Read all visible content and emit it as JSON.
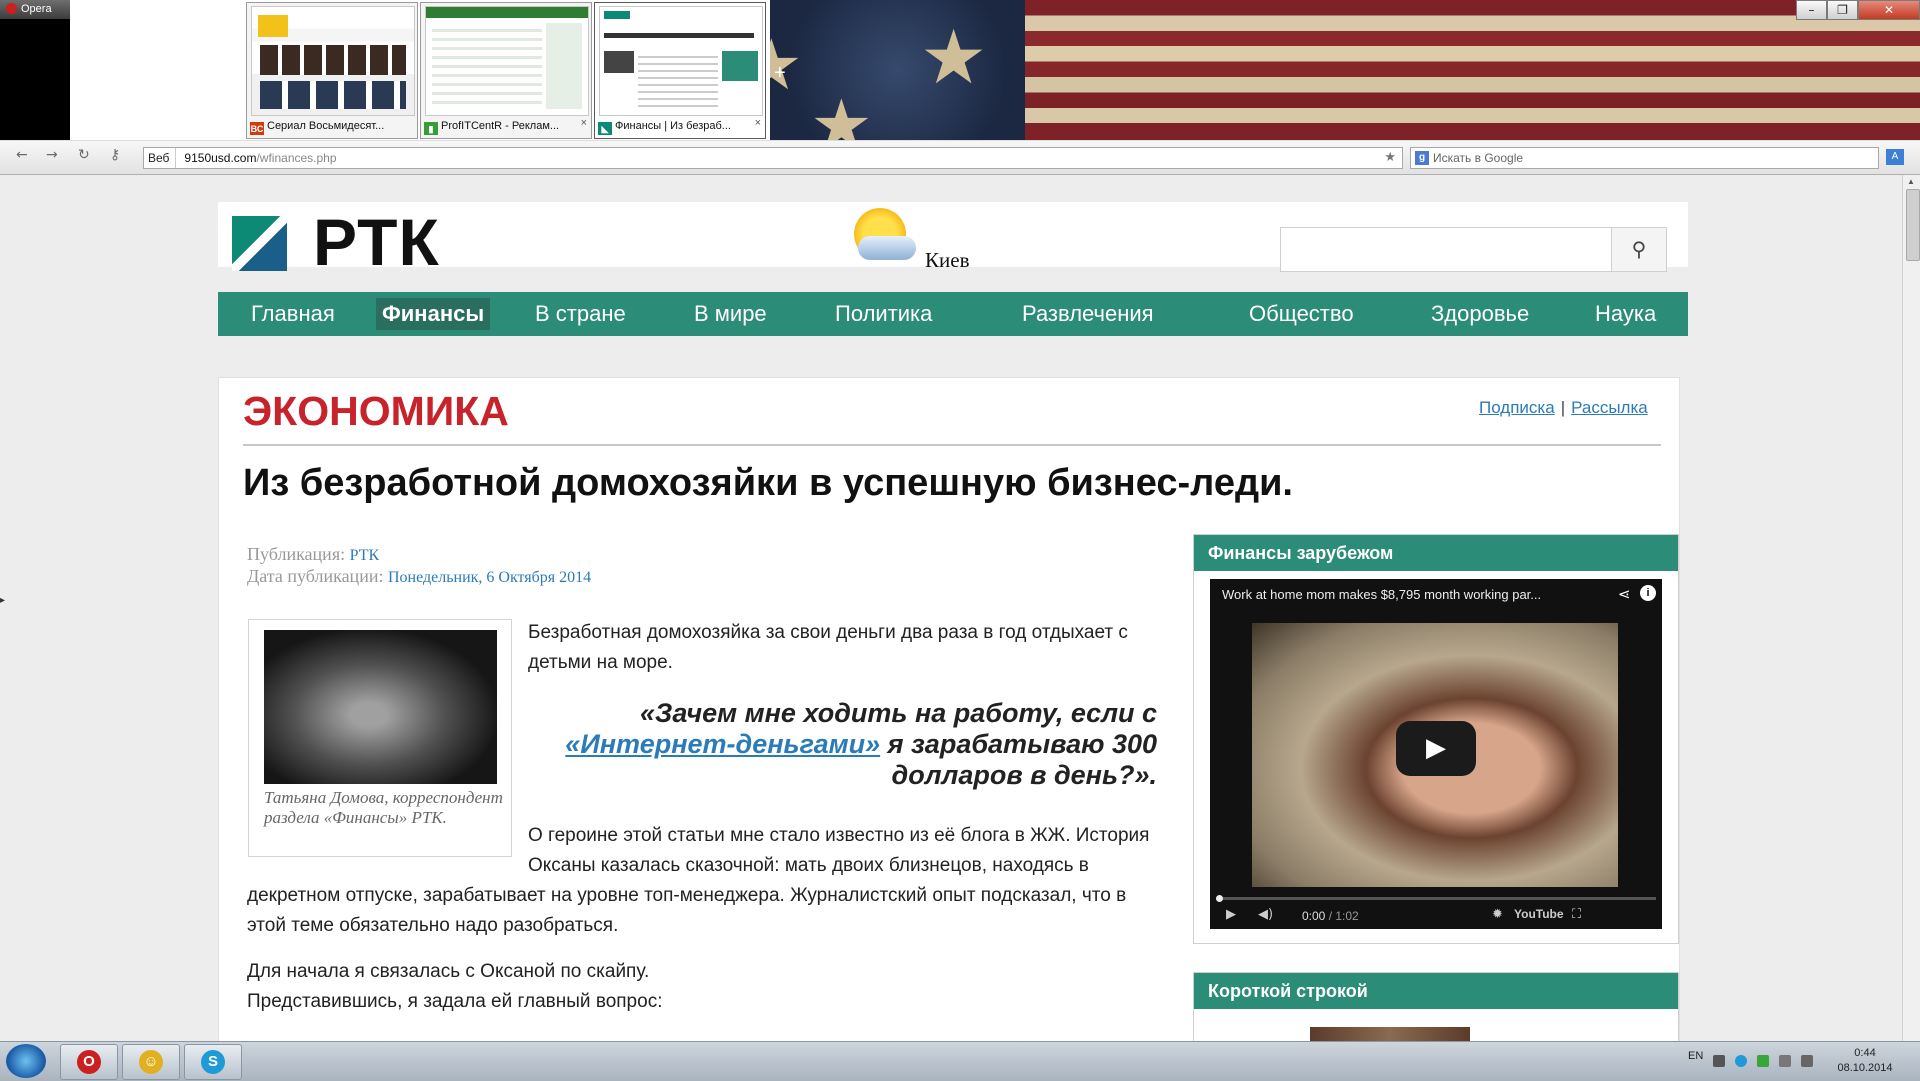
{
  "browser": {
    "menu_label": "Opera",
    "window_controls": {
      "minimize": "–",
      "maximize": "❐",
      "close": "✕"
    },
    "tabs": [
      {
        "title": "Сериал Восьмидесят...",
        "favicon_text": "ВС",
        "favicon_color": "#d03a10",
        "close": "×",
        "active": false
      },
      {
        "title": "ProfITCentR - Реклам...",
        "favicon_text": "▮",
        "favicon_color": "#3a9b3a",
        "close": "×",
        "active": false
      },
      {
        "title": "Финансы | Из безраб...",
        "favicon_text": "◣",
        "favicon_color": "#0c8a76",
        "close": "×",
        "active": true
      }
    ],
    "new_tab": "+",
    "nav": {
      "back": "←",
      "forward": "→",
      "reload": "↻",
      "key": "⚷"
    },
    "address": {
      "badge": "Веб",
      "host": "9150usd.com",
      "path": "/wfinances.php"
    },
    "bookmark_icon": "★",
    "search": {
      "engine_icon": "g",
      "placeholder": "Искать в Google"
    }
  },
  "site": {
    "logo": "РТК",
    "city": "Киев",
    "search_icon": "⚲",
    "nav": [
      "Главная",
      "Финансы",
      "В стране",
      "В мире",
      "Политика",
      "Развлечения",
      "Общество",
      "Здоровье",
      "Наука"
    ],
    "nav_active": "Финансы",
    "colors": {
      "accent": "#2b8c78",
      "section_red": "#c8222a",
      "link": "#2b7bb9"
    }
  },
  "article": {
    "section": "ЭКОНОМИКА",
    "links": {
      "subscribe": "Подписка",
      "separator": "|",
      "mailing": "Рассылка"
    },
    "headline": "Из безработной домохозяйки в успешную бизнес-леди.",
    "publication_label": "Публикация:",
    "publication": "РТК",
    "date_label": "Дата публикации:",
    "date": "Понедельник, 6 Октября 2014",
    "photo_caption": "Татьяна Домова, корреспондент раздела «Финансы» РТК.",
    "intro": "Безработная домохозяйка за свои деньги два раза в год отдыхает с детьми на море.",
    "quote_before": "«Зачем мне ходить на работу, если с ",
    "quote_link": "«Интернет-деньгами»",
    "quote_after": " я зарабатываю 300 долларов в день?».",
    "p2": "О героине этой статьи мне стало известно из её блога в ЖЖ. История Оксаны казалась сказочной: мать двоих близнецов, находясь в декретном отпуске, зарабатывает на уровне топ-менеджера. Журналистский опыт подсказал, что в этой теме обязательно надо разобраться.",
    "p3a": "Для начала я связалась с Оксаной по скайпу.",
    "p3b": "Представившись, я задала ей главный вопрос:"
  },
  "sidebar": {
    "widget1_title": "Финансы зарубежом",
    "video_title": "Work at home mom makes $8,795 month working par...",
    "video_share": "⋖",
    "video_info": "i",
    "play": "▶",
    "time_current": "0:00",
    "time_total": "/ 1:02",
    "progress": 0,
    "controls": {
      "play": "▶",
      "volume": "◀)",
      "settings": "✹",
      "youtube": "YouTube",
      "fullscreen": "⛶"
    },
    "widget2_title": "Короткой строкой"
  },
  "taskbar": {
    "apps": [
      {
        "name": "opera",
        "glyph": "O",
        "color": "#cc1f1f"
      },
      {
        "name": "chat",
        "glyph": "☺",
        "color": "#e0b020"
      },
      {
        "name": "skype",
        "glyph": "S",
        "color": "#1e9ad6"
      }
    ],
    "lang": "EN",
    "time": "0:44",
    "date": "08.10.2014"
  }
}
